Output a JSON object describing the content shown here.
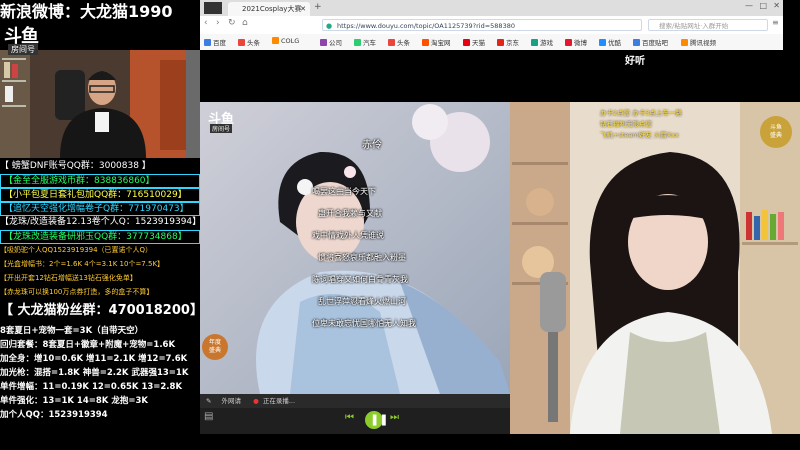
{
  "banner": {
    "text": "新浪微博：大龙猫1990"
  },
  "logo": {
    "main": "斗鱼",
    "sub": "房间号"
  },
  "info_rows": [
    {
      "text": "【 螃蟹DNF账号QQ群：3000838 】",
      "color": "#ffffff",
      "boxed": false
    },
    {
      "text": "【金至全服游戏币群：838836860】",
      "color": "#23ff63",
      "boxed": true
    },
    {
      "text": "【小平包夏日套礼包加QQ群：716510029】",
      "color": "#ffff4a",
      "boxed": true
    },
    {
      "text": "【追忆天空强化增幅卷子Q群：771970473】",
      "color": "#2fd6ff",
      "boxed": true
    },
    {
      "text": "【龙珠/改造装备12.13卷个人Q：1523919394】",
      "color": "#ffffff",
      "boxed": false
    },
    {
      "text": "【龙珠改造装备研邪玉QQ群：377734868】",
      "color": "#23ff63",
      "boxed": true
    },
    {
      "text": "【吸奶驼个人QQ1523919394（已置诺个人Q）",
      "color": "#ffcc33",
      "boxed": false
    },
    {
      "text": "【光盒增幅书：2个=1.6K 4个=3.1K 10个=7.5K】",
      "color": "#ffcc33",
      "boxed": false
    },
    {
      "text": "【开出开套12钻石增幅送13钻石强化免单】",
      "color": "#ffcc33",
      "boxed": false
    },
    {
      "text": "【赤龙珠可以换100万点券打造，多的盒子不算】",
      "color": "#ffcc33",
      "boxed": false
    }
  ],
  "fans": {
    "label": "【 大龙猫粉丝群：",
    "number": "470018200",
    "end": "】"
  },
  "price_rows": [
    "8套夏日+宠物一套=3K（自带天空）",
    "回归套餐：8套夏日+徽章+附魔+宠物=1.6K",
    "加全身：增10=0.6K 增11=2.1K 增12=7.6K",
    "加光枪：混搭=1.8K 神兽=2.2K 武器强13=1K",
    "单件增幅：11=0.19K 12=0.65K 13=2.8K",
    "单件强化：13=1K 14=8K 龙抱=3K",
    "加个人QQ：1523919394"
  ],
  "browser": {
    "tab_title": "2021Cosplay大赛",
    "url": "https://www.douyu.com/topic/OA1125739?rid=588380",
    "search_placeholder": "搜索/粘贴网址·入群开始",
    "bookmarks": [
      {
        "label": "百度",
        "color": "#3b7de0"
      },
      {
        "label": "头条",
        "color": "#e8453c"
      },
      {
        "label": "COLG",
        "color": "#ff8a00"
      },
      {
        "label": "公司",
        "color": "#8e44ad"
      },
      {
        "label": "汽车",
        "color": "#2ecc71"
      },
      {
        "label": "头条",
        "color": "#e8453c"
      },
      {
        "label": "淘宝网",
        "color": "#ff5000"
      },
      {
        "label": "天猫",
        "color": "#e60012"
      },
      {
        "label": "京东",
        "color": "#e1251b"
      },
      {
        "label": "游戏",
        "color": "#16a085"
      },
      {
        "label": "微博",
        "color": "#e6162d"
      },
      {
        "label": "优酷",
        "color": "#1f8fff"
      },
      {
        "label": "百度贴吧",
        "color": "#3b7de0"
      },
      {
        "label": "腾讯视频",
        "color": "#ff8a00"
      }
    ]
  },
  "stream": {
    "overlay_title": "好听",
    "room_logo": "斗鱼",
    "room_sub": "房间号",
    "song_title": "赤伶",
    "lyrics": [
      "喝罢这曲当今天下",
      "蛊开合我赖与又献",
      "戏中情戏外人凭谁说",
      "惯将喜怒哀乐都融入粉墨",
      "陈词唱穿又如何白骨青灰我",
      "乱世浮萍忍看烽火燃山河",
      "位卑未敢忘忧国哪怕无人知我"
    ],
    "player_status": "正在录播...",
    "player_mode": "外网请",
    "gift_lines": [
      "办卡2点您 办卡3点上车一路",
      "钻石福利无限点您",
      "飞机+steam好友 火箭Xxx"
    ],
    "badge_left": "年度\n盛典",
    "badge_right": "斗鱼\n盛典"
  }
}
